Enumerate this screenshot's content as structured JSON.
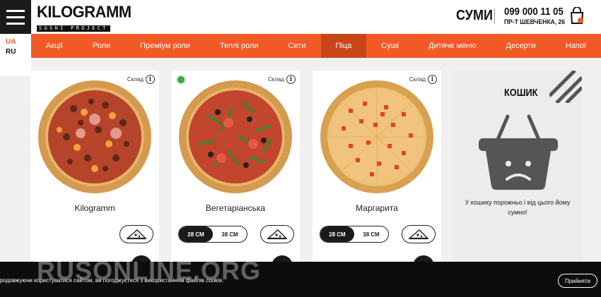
{
  "header": {
    "logo_main": "KILOGRAMM",
    "logo_sub": "SUSHI PROJECT",
    "city": "СУМИ",
    "phone": "099 000 11 05",
    "address": "ПР-Т ШЕВЧЕНКА, 26"
  },
  "languages": [
    "UA",
    "RU"
  ],
  "nav": {
    "items": [
      "Акції",
      "Роли",
      "Преміум роли",
      "Теплі роли",
      "Сети",
      "Піца",
      "Суші",
      "Дитяче меню",
      "Десерти",
      "Напої"
    ],
    "active": "Піца"
  },
  "products": [
    {
      "name": "Kilogramm",
      "stock_label": "Склад",
      "sizes": [],
      "veg": false
    },
    {
      "name": "Вегетаріанська",
      "stock_label": "Склад",
      "sizes": [
        "28 СМ",
        "38 СМ"
      ],
      "selected_size": "28 СМ",
      "veg": true
    },
    {
      "name": "Маргарита",
      "stock_label": "Склад",
      "sizes": [
        "28 СМ",
        "38 СМ"
      ],
      "selected_size": "28 СМ",
      "veg": false
    }
  ],
  "cart": {
    "title": "КОШИК",
    "empty_message": "У кошику порожньо і від цього йому сумно!"
  },
  "cookie": {
    "text": "родовжуючи користуватися сайтом, ви погоджуєтеся з використанням файлів cookie.",
    "accept_label": "Прийняти"
  },
  "watermark": "RUSONLINE.ORG",
  "colors": {
    "accent": "#f15a24",
    "dark": "#1a1a1a"
  }
}
